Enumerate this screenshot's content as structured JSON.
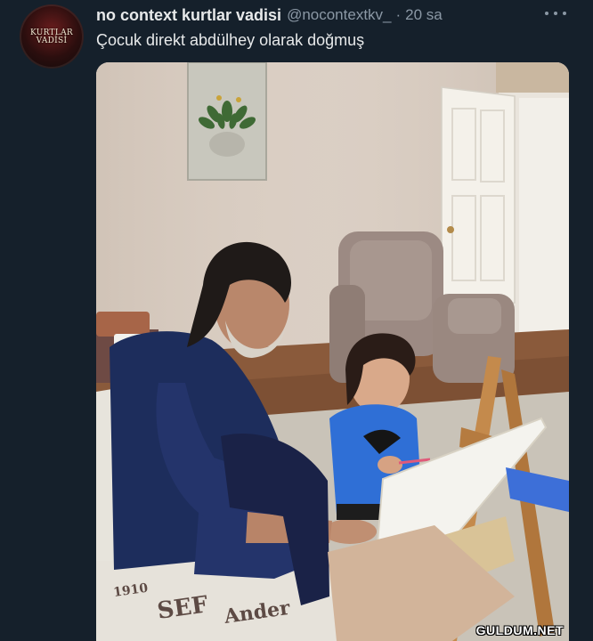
{
  "tweet": {
    "display_name": "no context kurtlar vadisi",
    "handle": "@nocontextkv_",
    "separator": "·",
    "time": "20 sa",
    "text": "Çocuk direkt abdülhey olarak doğmuş",
    "avatar_logo_text": "KURTLAR VADİSİ",
    "more_icon": "more-horizontal-icon"
  },
  "media": {
    "watermark": "GULDUM.NET"
  },
  "colors": {
    "background": "#15202b",
    "primary_text": "#e7e9ea",
    "secondary_text": "#8b98a5"
  }
}
